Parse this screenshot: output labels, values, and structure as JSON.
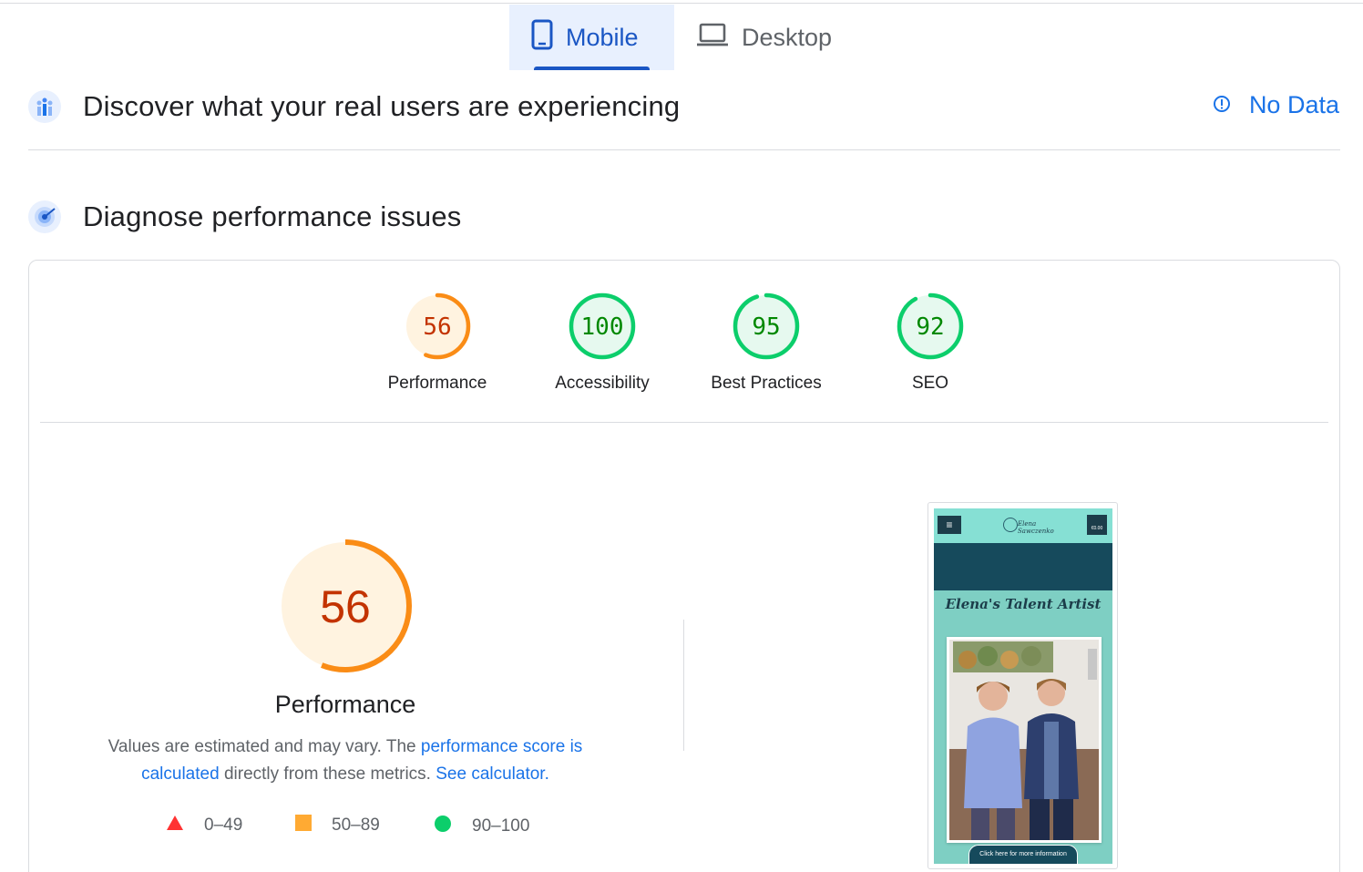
{
  "tabs": {
    "mobile": "Mobile",
    "desktop": "Desktop"
  },
  "crux": {
    "title": "Discover what your real users are experiencing",
    "status": "No Data"
  },
  "diagnose": {
    "title": "Diagnose performance issues"
  },
  "scores": [
    {
      "label": "Performance",
      "value": "56",
      "score": 56,
      "color": "#fa8c16",
      "bg": "#fff3e0",
      "textColor": "#c33300"
    },
    {
      "label": "Accessibility",
      "value": "100",
      "score": 100,
      "color": "#0cce6b",
      "bg": "#e6f9ef",
      "textColor": "#008800"
    },
    {
      "label": "Best Practices",
      "value": "95",
      "score": 95,
      "color": "#0cce6b",
      "bg": "#e6f9ef",
      "textColor": "#008800"
    },
    {
      "label": "SEO",
      "value": "92",
      "score": 92,
      "color": "#0cce6b",
      "bg": "#e6f9ef",
      "textColor": "#008800"
    }
  ],
  "performance": {
    "value": "56",
    "title": "Performance",
    "desc_1": "Values are estimated and may vary. The ",
    "link_1": "performance score is calculated",
    "desc_2": " directly from these metrics. ",
    "link_2": "See calculator."
  },
  "legend": [
    {
      "range": "0–49",
      "shape": "triangle",
      "color": "#ff3333"
    },
    {
      "range": "50–89",
      "shape": "square",
      "color": "#ffaa33"
    },
    {
      "range": "90–100",
      "shape": "circle",
      "color": "#0cce6b"
    }
  ],
  "thumbnail": {
    "logo_line_1": "Elena",
    "logo_line_2": "Sawczenko",
    "cart": "€0.00",
    "title": "Elena's Talent Artist",
    "button": "Click here for more information"
  },
  "colors": {
    "accent": "#1a73e8",
    "tab_active": "#1a56c4",
    "tab_active_bg": "#e8f0fe"
  }
}
